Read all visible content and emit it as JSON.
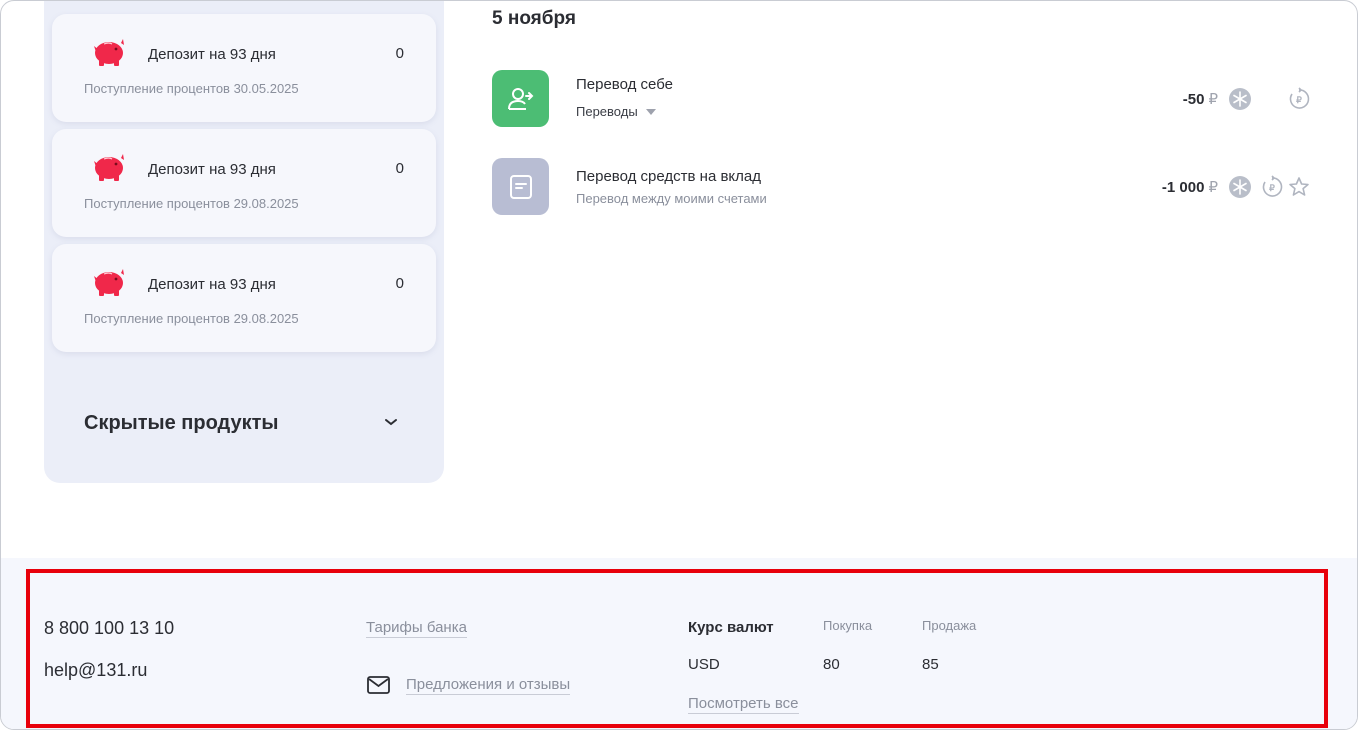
{
  "sidebar": {
    "deposits": [
      {
        "title": "Депозит на 93 дня",
        "value": "0",
        "subtitle": "Поступление процентов 30.05.2025",
        "icon": "piggy-bank-icon"
      },
      {
        "title": "Депозит на 93 дня",
        "value": "0",
        "subtitle": "Поступление процентов 29.08.2025",
        "icon": "piggy-bank-icon"
      },
      {
        "title": "Депозит на 93 дня",
        "value": "0",
        "subtitle": "Поступление процентов 29.08.2025",
        "icon": "piggy-bank-icon"
      }
    ],
    "hidden_products_label": "Скрытые продукты"
  },
  "feed": {
    "date": "5 ноября",
    "transactions": [
      {
        "title": "Перевод себе",
        "category": "Переводы",
        "amount": "-50",
        "currency": "₽",
        "icon": "person-transfer-icon",
        "icon_color": "#4cbd74"
      },
      {
        "title": "Перевод средств на вклад",
        "subtitle": "Перевод между моими счетами",
        "amount": "-1 000",
        "currency": "₽",
        "icon": "document-icon",
        "icon_color": "#b8bdd3"
      }
    ]
  },
  "footer": {
    "phone": "8 800 100 13 10",
    "email": "help@131.ru",
    "tariffs_link": "Тарифы банка",
    "feedback_link": "Предложения и отзывы",
    "rates": {
      "title": "Курс валют",
      "buy_label": "Покупка",
      "sell_label": "Продажа",
      "rows": [
        {
          "currency": "USD",
          "buy": "80",
          "sell": "85"
        }
      ],
      "see_all_link": "Посмотреть все"
    }
  },
  "colors": {
    "accent_red": "#f0284a",
    "highlight_outline": "#e8000b",
    "green_icon": "#4cbd74"
  }
}
